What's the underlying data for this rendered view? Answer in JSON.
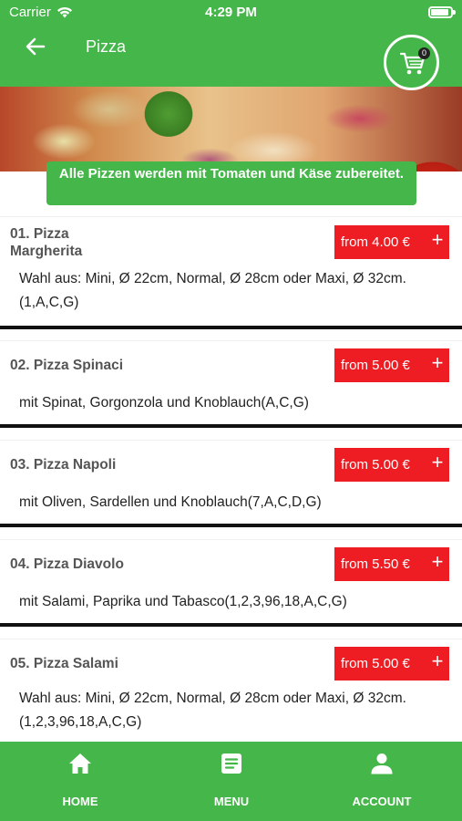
{
  "status": {
    "carrier": "Carrier",
    "time": "4:29 PM"
  },
  "header": {
    "title": "Pizza",
    "cart_count": "0"
  },
  "banner": {
    "note": "Alle Pizzen werden mit Tomaten und Käse zubereitet."
  },
  "products": [
    {
      "name": "01. Pizza Margherita",
      "price": "from 4.00 €",
      "description": "Wahl aus: Mini, Ø 22cm, Normal, Ø 28cm oder Maxi, Ø 32cm.(1,A,C,G)"
    },
    {
      "name": "02. Pizza Spinaci",
      "price": "from 5.00 €",
      "description": "mit Spinat, Gorgonzola und Knoblauch(A,C,G)"
    },
    {
      "name": "03. Pizza Napoli",
      "price": "from 5.00 €",
      "description": "mit Oliven, Sardellen und Knoblauch(7,A,C,D,G)"
    },
    {
      "name": "04. Pizza Diavolo",
      "price": "from 5.50 €",
      "description": "mit Salami, Paprika und Tabasco(1,2,3,96,18,A,C,G)"
    },
    {
      "name": "05. Pizza Salami",
      "price": "from 5.00 €",
      "description": "Wahl aus: Mini, Ø 22cm, Normal, Ø 28cm oder Maxi, Ø 32cm.(1,2,3,96,18,A,C,G)"
    }
  ],
  "nav": {
    "home": "HOME",
    "menu": "MENU",
    "account": "ACCOUNT"
  },
  "colors": {
    "brand_green": "#45b649",
    "price_red": "#ee1d23"
  }
}
